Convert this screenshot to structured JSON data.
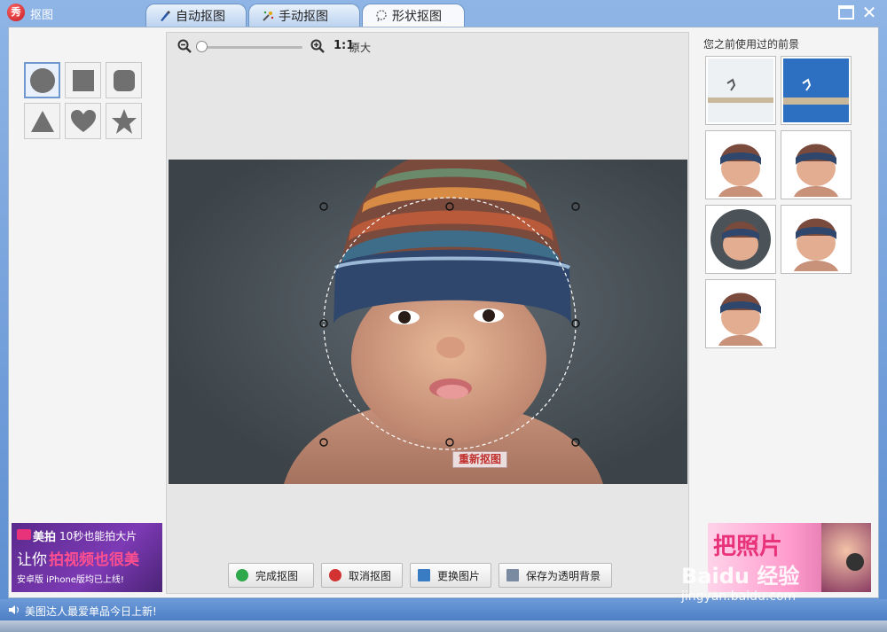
{
  "window": {
    "title": "抠图",
    "tabs": [
      {
        "label": "自动抠图",
        "active": false
      },
      {
        "label": "手动抠图",
        "active": false
      },
      {
        "label": "形状抠图",
        "active": true
      }
    ]
  },
  "shapes": [
    {
      "name": "circle",
      "selected": true
    },
    {
      "name": "square",
      "selected": false
    },
    {
      "name": "rounded-square",
      "selected": false
    },
    {
      "name": "triangle",
      "selected": false
    },
    {
      "name": "heart",
      "selected": false
    },
    {
      "name": "star",
      "selected": false
    }
  ],
  "zoom": {
    "ratio": "1:1",
    "original_label": "原大"
  },
  "editor": {
    "reset_label": "重新抠图"
  },
  "actions": {
    "finish": "完成抠图",
    "cancel": "取消抠图",
    "replace": "更换图片",
    "save_transparent": "保存为透明背景"
  },
  "history": {
    "title": "您之前使用过的前景"
  },
  "ads": {
    "left": {
      "brand": "美拍",
      "line1": "10秒也能拍大片",
      "line2a": "让你",
      "line2b": "拍视频也很美",
      "line3": "安卓版  iPhone版均已上线!"
    },
    "right": {
      "text": "把照片"
    }
  },
  "status": {
    "text": "美图达人最爱单品今日上新!"
  },
  "watermark": {
    "line1": "Baidu 经验",
    "line2": "jingyan.baidu.com"
  }
}
